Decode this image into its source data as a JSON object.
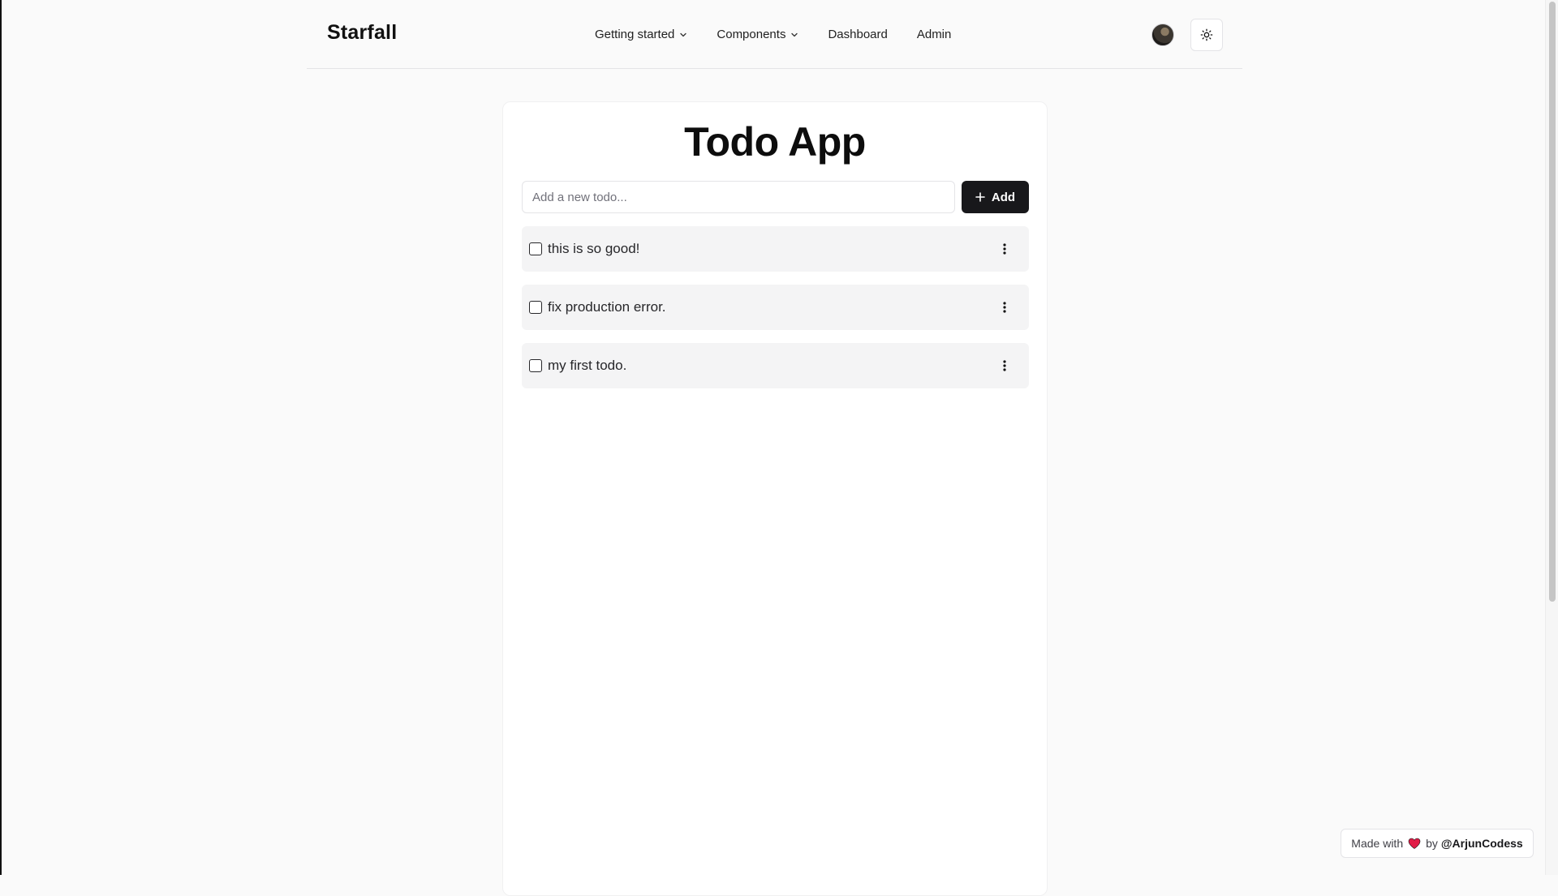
{
  "header": {
    "brand": "Starfall",
    "nav": [
      {
        "label": "Getting started",
        "has_dropdown": true
      },
      {
        "label": "Components",
        "has_dropdown": true
      },
      {
        "label": "Dashboard",
        "has_dropdown": false
      },
      {
        "label": "Admin",
        "has_dropdown": false
      }
    ],
    "theme_icon": "sun-icon"
  },
  "main": {
    "title": "Todo App",
    "input": {
      "placeholder": "Add a new todo...",
      "value": ""
    },
    "add_button": {
      "label": "Add",
      "icon": "plus-icon"
    },
    "todos": [
      {
        "text": "this is so good!",
        "checked": false
      },
      {
        "text": "fix production error.",
        "checked": false
      },
      {
        "text": "my first todo.",
        "checked": false
      }
    ]
  },
  "footer_badge": {
    "made_with": "Made with",
    "by": "by",
    "handle": "@ArjunCodess"
  },
  "colors": {
    "background": "#fafafa",
    "card": "#ffffff",
    "todo_bg": "#f4f4f5",
    "primary": "#18181b",
    "heart": "#e11d48"
  }
}
